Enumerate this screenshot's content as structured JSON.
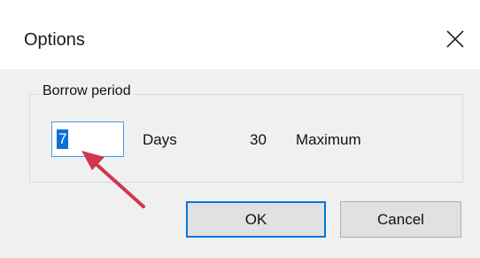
{
  "window": {
    "title": "Options",
    "close_icon": "close-icon"
  },
  "group": {
    "label": "Borrow period"
  },
  "days_input": {
    "value": "7"
  },
  "days_label": "Days",
  "maximum": {
    "value": "30",
    "label": "Maximum"
  },
  "buttons": {
    "ok": "OK",
    "cancel": "Cancel"
  },
  "annotation": {
    "arrow_color": "#d0364e"
  },
  "colors": {
    "accent": "#0078d7",
    "selection": "#0a6fd6"
  }
}
